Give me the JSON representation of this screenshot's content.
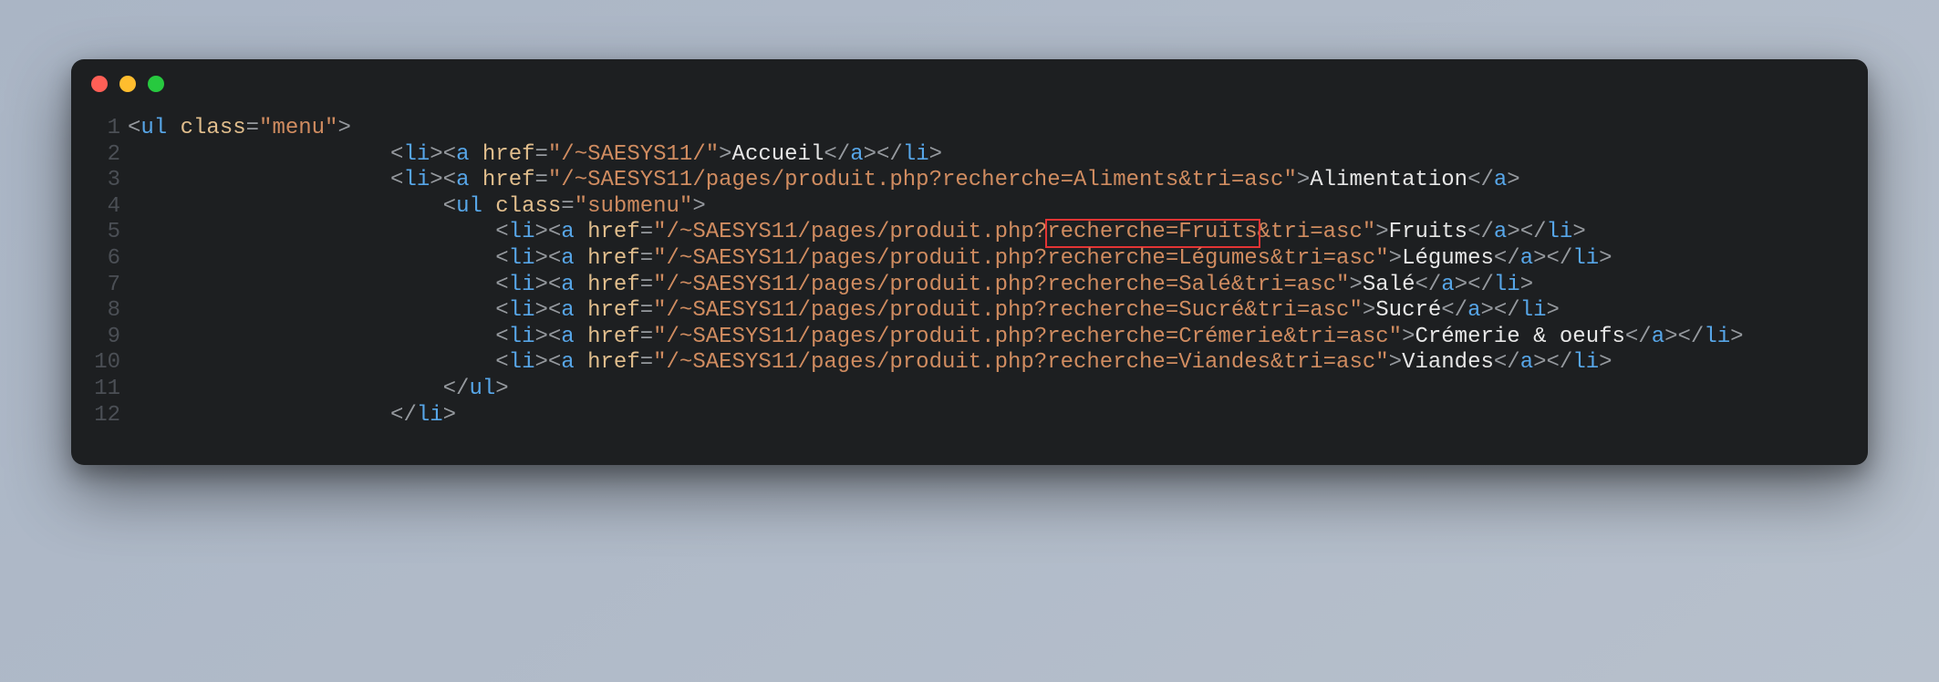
{
  "window": {
    "traffic": [
      "red",
      "yellow",
      "green"
    ]
  },
  "code": {
    "lines": [
      {
        "n": 1,
        "segments": [
          {
            "t": "<",
            "c": "pun"
          },
          {
            "t": "ul ",
            "c": "tag"
          },
          {
            "t": "class",
            "c": "attr"
          },
          {
            "t": "=",
            "c": "pun"
          },
          {
            "t": "\"menu\"",
            "c": "str"
          },
          {
            "t": ">",
            "c": "pun"
          }
        ],
        "indent": 0
      },
      {
        "n": 2,
        "segments": [
          {
            "t": "<",
            "c": "pun"
          },
          {
            "t": "li",
            "c": "tag"
          },
          {
            "t": "><",
            "c": "pun"
          },
          {
            "t": "a ",
            "c": "tag"
          },
          {
            "t": "href",
            "c": "attr"
          },
          {
            "t": "=",
            "c": "pun"
          },
          {
            "t": "\"/~SAESYS11/\"",
            "c": "str"
          },
          {
            "t": ">",
            "c": "pun"
          },
          {
            "t": "Accueil",
            "c": "txt"
          },
          {
            "t": "</",
            "c": "pun"
          },
          {
            "t": "a",
            "c": "tag"
          },
          {
            "t": "></",
            "c": "pun"
          },
          {
            "t": "li",
            "c": "tag"
          },
          {
            "t": ">",
            "c": "pun"
          }
        ],
        "indent": 20
      },
      {
        "n": 3,
        "segments": [
          {
            "t": "<",
            "c": "pun"
          },
          {
            "t": "li",
            "c": "tag"
          },
          {
            "t": "><",
            "c": "pun"
          },
          {
            "t": "a ",
            "c": "tag"
          },
          {
            "t": "href",
            "c": "attr"
          },
          {
            "t": "=",
            "c": "pun"
          },
          {
            "t": "\"/~SAESYS11/pages/produit.php?recherche=Aliments&tri=asc\"",
            "c": "str"
          },
          {
            "t": ">",
            "c": "pun"
          },
          {
            "t": "Alimentation",
            "c": "txt"
          },
          {
            "t": "</",
            "c": "pun"
          },
          {
            "t": "a",
            "c": "tag"
          },
          {
            "t": ">",
            "c": "pun"
          }
        ],
        "indent": 20
      },
      {
        "n": 4,
        "segments": [
          {
            "t": "<",
            "c": "pun"
          },
          {
            "t": "ul ",
            "c": "tag"
          },
          {
            "t": "class",
            "c": "attr"
          },
          {
            "t": "=",
            "c": "pun"
          },
          {
            "t": "\"submenu\"",
            "c": "str"
          },
          {
            "t": ">",
            "c": "pun"
          }
        ],
        "indent": 24
      },
      {
        "n": 5,
        "segments": [
          {
            "t": "<",
            "c": "pun"
          },
          {
            "t": "li",
            "c": "tag"
          },
          {
            "t": "><",
            "c": "pun"
          },
          {
            "t": "a ",
            "c": "tag"
          },
          {
            "t": "href",
            "c": "attr"
          },
          {
            "t": "=",
            "c": "pun"
          },
          {
            "t": "\"/~SAESYS11/pages/produit.php?",
            "c": "str"
          },
          {
            "t": "recherche=Fruits",
            "c": "str",
            "box": true
          },
          {
            "t": "&tri=asc\"",
            "c": "str"
          },
          {
            "t": ">",
            "c": "pun"
          },
          {
            "t": "Fruits",
            "c": "txt"
          },
          {
            "t": "</",
            "c": "pun"
          },
          {
            "t": "a",
            "c": "tag"
          },
          {
            "t": "></",
            "c": "pun"
          },
          {
            "t": "li",
            "c": "tag"
          },
          {
            "t": ">",
            "c": "pun"
          }
        ],
        "indent": 28
      },
      {
        "n": 6,
        "segments": [
          {
            "t": "<",
            "c": "pun"
          },
          {
            "t": "li",
            "c": "tag"
          },
          {
            "t": "><",
            "c": "pun"
          },
          {
            "t": "a ",
            "c": "tag"
          },
          {
            "t": "href",
            "c": "attr"
          },
          {
            "t": "=",
            "c": "pun"
          },
          {
            "t": "\"/~SAESYS11/pages/produit.php?recherche=Légumes&tri=asc\"",
            "c": "str"
          },
          {
            "t": ">",
            "c": "pun"
          },
          {
            "t": "Légumes",
            "c": "txt"
          },
          {
            "t": "</",
            "c": "pun"
          },
          {
            "t": "a",
            "c": "tag"
          },
          {
            "t": "></",
            "c": "pun"
          },
          {
            "t": "li",
            "c": "tag"
          },
          {
            "t": ">",
            "c": "pun"
          }
        ],
        "indent": 28
      },
      {
        "n": 7,
        "segments": [
          {
            "t": "<",
            "c": "pun"
          },
          {
            "t": "li",
            "c": "tag"
          },
          {
            "t": "><",
            "c": "pun"
          },
          {
            "t": "a ",
            "c": "tag"
          },
          {
            "t": "href",
            "c": "attr"
          },
          {
            "t": "=",
            "c": "pun"
          },
          {
            "t": "\"/~SAESYS11/pages/produit.php?recherche=Salé&tri=asc\"",
            "c": "str"
          },
          {
            "t": ">",
            "c": "pun"
          },
          {
            "t": "Salé",
            "c": "txt"
          },
          {
            "t": "</",
            "c": "pun"
          },
          {
            "t": "a",
            "c": "tag"
          },
          {
            "t": "></",
            "c": "pun"
          },
          {
            "t": "li",
            "c": "tag"
          },
          {
            "t": ">",
            "c": "pun"
          }
        ],
        "indent": 28
      },
      {
        "n": 8,
        "segments": [
          {
            "t": "<",
            "c": "pun"
          },
          {
            "t": "li",
            "c": "tag"
          },
          {
            "t": "><",
            "c": "pun"
          },
          {
            "t": "a ",
            "c": "tag"
          },
          {
            "t": "href",
            "c": "attr"
          },
          {
            "t": "=",
            "c": "pun"
          },
          {
            "t": "\"/~SAESYS11/pages/produit.php?recherche=Sucré&tri=asc\"",
            "c": "str"
          },
          {
            "t": ">",
            "c": "pun"
          },
          {
            "t": "Sucré",
            "c": "txt"
          },
          {
            "t": "</",
            "c": "pun"
          },
          {
            "t": "a",
            "c": "tag"
          },
          {
            "t": "></",
            "c": "pun"
          },
          {
            "t": "li",
            "c": "tag"
          },
          {
            "t": ">",
            "c": "pun"
          }
        ],
        "indent": 28
      },
      {
        "n": 9,
        "segments": [
          {
            "t": "<",
            "c": "pun"
          },
          {
            "t": "li",
            "c": "tag"
          },
          {
            "t": "><",
            "c": "pun"
          },
          {
            "t": "a ",
            "c": "tag"
          },
          {
            "t": "href",
            "c": "attr"
          },
          {
            "t": "=",
            "c": "pun"
          },
          {
            "t": "\"/~SAESYS11/pages/produit.php?recherche=Crémerie&tri=asc\"",
            "c": "str"
          },
          {
            "t": ">",
            "c": "pun"
          },
          {
            "t": "Crémerie & oeufs",
            "c": "txt"
          },
          {
            "t": "</",
            "c": "pun"
          },
          {
            "t": "a",
            "c": "tag"
          },
          {
            "t": "></",
            "c": "pun"
          },
          {
            "t": "li",
            "c": "tag"
          },
          {
            "t": ">",
            "c": "pun"
          }
        ],
        "indent": 28
      },
      {
        "n": 10,
        "segments": [
          {
            "t": "<",
            "c": "pun"
          },
          {
            "t": "li",
            "c": "tag"
          },
          {
            "t": "><",
            "c": "pun"
          },
          {
            "t": "a ",
            "c": "tag"
          },
          {
            "t": "href",
            "c": "attr"
          },
          {
            "t": "=",
            "c": "pun"
          },
          {
            "t": "\"/~SAESYS11/pages/produit.php?recherche=Viandes&tri=asc\"",
            "c": "str"
          },
          {
            "t": ">",
            "c": "pun"
          },
          {
            "t": "Viandes",
            "c": "txt"
          },
          {
            "t": "</",
            "c": "pun"
          },
          {
            "t": "a",
            "c": "tag"
          },
          {
            "t": "></",
            "c": "pun"
          },
          {
            "t": "li",
            "c": "tag"
          },
          {
            "t": ">",
            "c": "pun"
          }
        ],
        "indent": 28
      },
      {
        "n": 11,
        "segments": [
          {
            "t": "</",
            "c": "pun"
          },
          {
            "t": "ul",
            "c": "tag"
          },
          {
            "t": ">",
            "c": "pun"
          }
        ],
        "indent": 24
      },
      {
        "n": 12,
        "segments": [
          {
            "t": "</",
            "c": "pun"
          },
          {
            "t": "li",
            "c": "tag"
          },
          {
            "t": ">",
            "c": "pun"
          }
        ],
        "indent": 20
      }
    ]
  },
  "highlight": {
    "text": "recherche=Fruits",
    "line": 5
  }
}
